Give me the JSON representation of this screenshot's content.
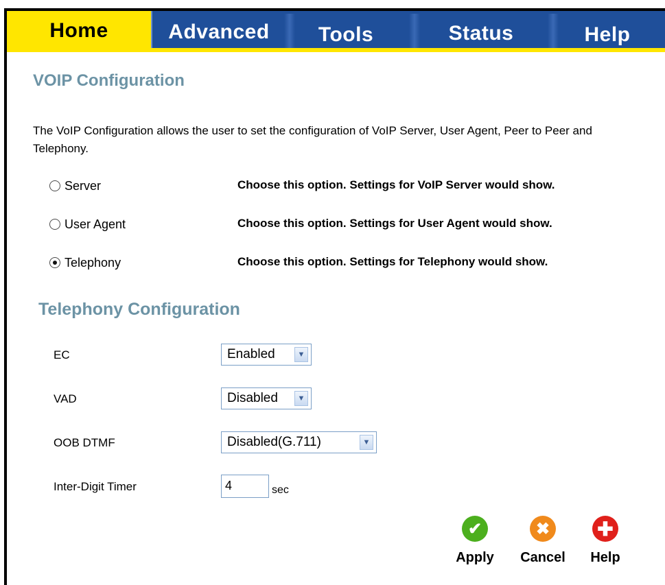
{
  "tabs": [
    {
      "label": "Home",
      "active": true
    },
    {
      "label": "Advanced",
      "active": false
    },
    {
      "label": "Tools",
      "active": false
    },
    {
      "label": "Status",
      "active": false
    },
    {
      "label": "Help",
      "active": false
    }
  ],
  "colors": {
    "tab_active": "#ffe600",
    "tab_bar": "#1f4f9a",
    "heading": "#6c93a5"
  },
  "page": {
    "title": "VOIP Configuration",
    "description": "The VoIP Configuration allows the user to set the configuration of VoIP Server, User Agent, Peer to Peer and Telephony."
  },
  "options": [
    {
      "label": "Server",
      "note": "Choose this option. Settings for VoIP Server would show.",
      "selected": false
    },
    {
      "label": "User Agent",
      "note": "Choose this option. Settings for User Agent would show.",
      "selected": false
    },
    {
      "label": "Telephony",
      "note": "Choose this option. Settings for Telephony would show.",
      "selected": true
    }
  ],
  "telephony": {
    "title": "Telephony Configuration",
    "ec": {
      "label": "EC",
      "value": "Enabled"
    },
    "vad": {
      "label": "VAD",
      "value": "Disabled"
    },
    "oob": {
      "label": "OOB DTMF",
      "value": "Disabled(G.711)"
    },
    "timer": {
      "label": "Inter-Digit Timer",
      "value": "4",
      "unit": "sec"
    }
  },
  "actions": {
    "apply": {
      "label": "Apply",
      "icon": "check-icon",
      "color": "#4caf1e"
    },
    "cancel": {
      "label": "Cancel",
      "icon": "x-icon",
      "color": "#f08a1c"
    },
    "help": {
      "label": "Help",
      "icon": "plus-icon",
      "color": "#e0201b"
    }
  }
}
